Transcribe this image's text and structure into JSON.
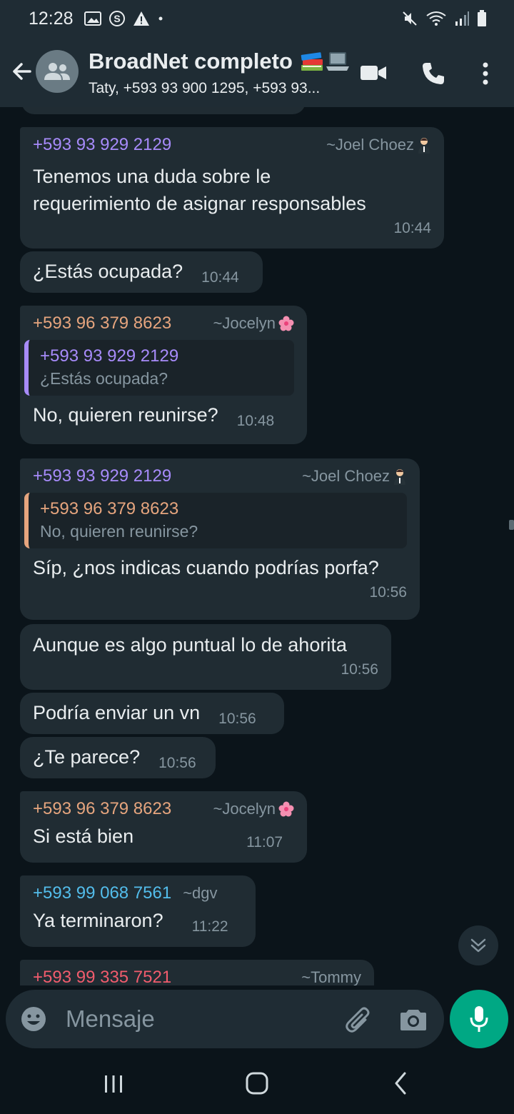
{
  "status_bar": {
    "time": "12:28",
    "icons_left": [
      "gallery-icon",
      "s-icon",
      "warning-icon",
      "dot-icon"
    ],
    "icons_right": [
      "mute-icon",
      "wifi-icon",
      "signal-icon",
      "battery-icon"
    ]
  },
  "header": {
    "title": "BroadNet completo",
    "title_emoji": [
      "books-emoji",
      "laptop-emoji"
    ],
    "subtitle": "Taty, +593 93 900 1295, +593 93..."
  },
  "messages": [
    {
      "sender": "+593 93 929 2129",
      "alias": "~Joel Choez",
      "text_lines": [
        "Tenemos una duda sobre le",
        "requerimiento de asignar responsables"
      ],
      "time": "10:44"
    },
    {
      "text": "¿Estás ocupada?",
      "time": "10:44"
    },
    {
      "sender": "+593 96 379 8623",
      "alias": "~Jocelyn",
      "quote_sender": "+593 93 929 2129",
      "quote_text": "¿Estás ocupada?",
      "text": "No, quieren reunirse?",
      "time": "10:48"
    },
    {
      "sender": "+593 93 929 2129",
      "alias": "~Joel Choez",
      "quote_sender": "+593 96 379 8623",
      "quote_text": "No, quieren reunirse?",
      "text": "Síp, ¿nos indicas cuando podrías porfa?",
      "time": "10:56"
    },
    {
      "text": "Aunque es algo puntual lo de ahorita",
      "time": "10:56"
    },
    {
      "text": "Podría enviar un vn",
      "time": "10:56"
    },
    {
      "text": "¿Te parece?",
      "time": "10:56"
    },
    {
      "sender": "+593 96 379 8623",
      "alias": "~Jocelyn",
      "text": "Si está bien",
      "time": "11:07"
    },
    {
      "sender": "+593 99 068 7561",
      "alias": "~dgv",
      "text": "Ya terminaron?",
      "time": "11:22"
    },
    {
      "sender": "+593 99 335 7521",
      "alias": "~Tommy"
    }
  ],
  "colors": {
    "joel": "#a78bfa",
    "jocelyn": "#e6a57e",
    "dgv": "#53bdeb",
    "tommy": "#f15c6d",
    "accent": "#00a884"
  },
  "composer": {
    "placeholder": "Mensaje"
  }
}
